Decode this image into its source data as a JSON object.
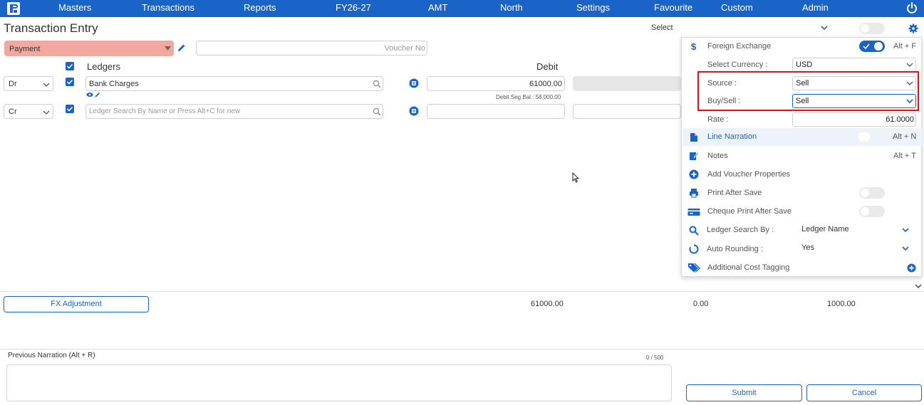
{
  "nav": {
    "items": [
      "Masters",
      "Transactions",
      "Reports",
      "FY26-27",
      "AMT",
      "North",
      "Settings",
      "Favourite",
      "Custom",
      "Admin"
    ]
  },
  "page": {
    "title": "Transaction Entry",
    "select_label": "Select"
  },
  "voucher": {
    "type": "Payment",
    "number_placeholder": "Voucher No"
  },
  "table": {
    "ledgers_header": "Ledgers",
    "debit_header": "Debit",
    "rows": [
      {
        "drcr": "Dr",
        "ledger": "Bank Charges",
        "debit": "61000.00",
        "balance": "Debit Seg Bal.: 58,000.00"
      },
      {
        "drcr": "Cr",
        "ledger_placeholder": "Ledger Search By Name or Press Alt+C for new"
      }
    ]
  },
  "panel": {
    "foreign_exchange": {
      "label": "Foreign Exchange",
      "shortcut": "Alt + F",
      "enabled": true
    },
    "select_currency": {
      "label": "Select Currency :",
      "value": "USD"
    },
    "source": {
      "label": "Source :",
      "value": "Sell"
    },
    "buy_sell": {
      "label": "Buy/Sell :",
      "value": "Sell"
    },
    "rate": {
      "label": "Rate :",
      "value": "61.0000"
    },
    "line_narration": {
      "label": "Line Narration",
      "shortcut": "Alt + N"
    },
    "notes": {
      "label": "Notes",
      "shortcut": "Alt + T"
    },
    "add_voucher_properties": "Add Voucher Properties",
    "print_after_save": "Print After Save",
    "cheque_print_after_save": "Cheque Print After Save",
    "ledger_search_by": {
      "label": "Ledger Search By :",
      "value": "Ledger Name"
    },
    "auto_rounding": {
      "label": "Auto Rounding :",
      "value": "Yes"
    },
    "additional_cost_tagging": "Additional Cost Tagging"
  },
  "footer": {
    "fx_adjustment": "FX Adjustment",
    "totals": [
      "61000.00",
      "0.00",
      "1000.00"
    ],
    "previous_narration": "Previous Narration (Alt + R)",
    "char_count": "0 / 500",
    "submit": "Submit",
    "cancel": "Cancel"
  },
  "colors": {
    "brand": "#1a64c8",
    "voucher_type_bg": "#f4a79f",
    "highlight_border": "#d9141c"
  }
}
